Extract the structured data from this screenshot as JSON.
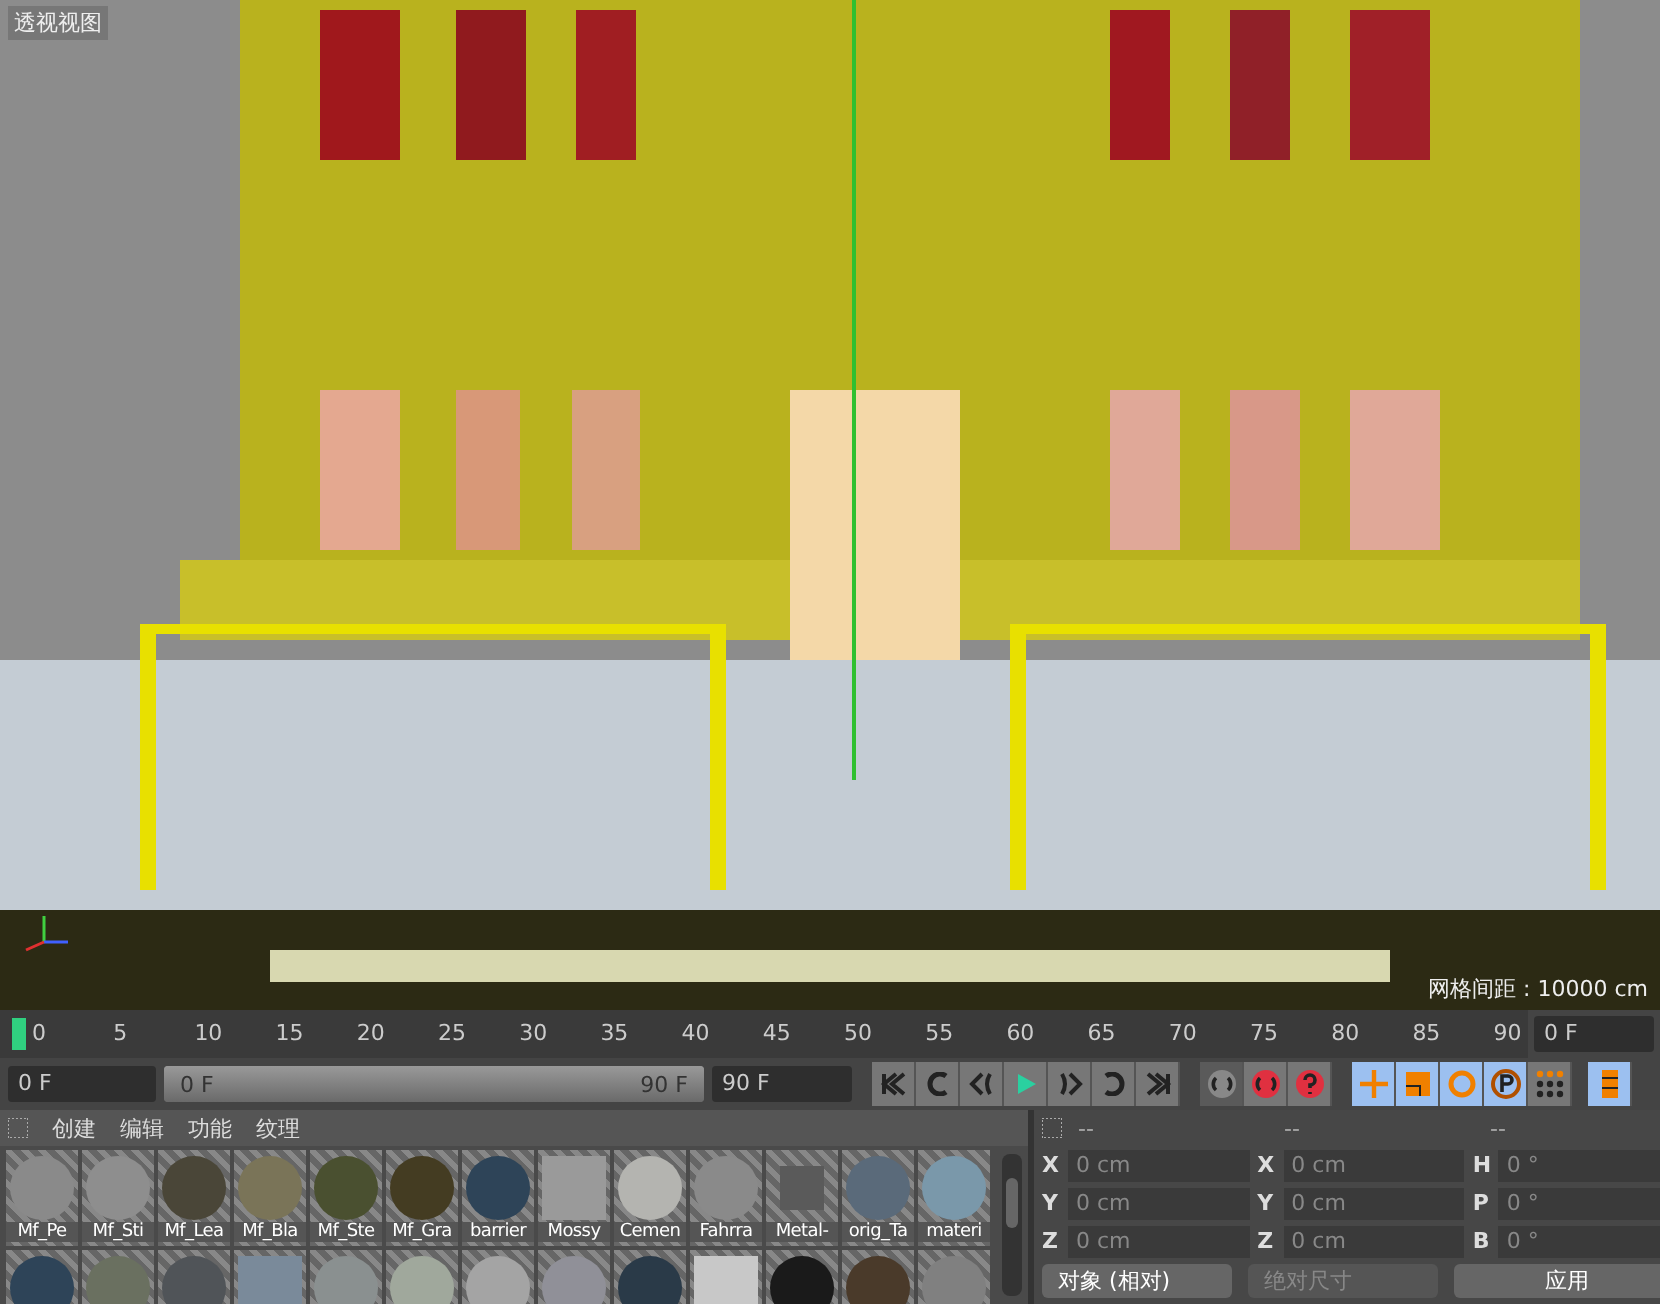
{
  "viewport": {
    "title": "透视视图",
    "grid_spacing": "网格间距 : 10000 cm"
  },
  "timeline": {
    "ticks": [
      "0",
      "5",
      "10",
      "15",
      "20",
      "25",
      "30",
      "35",
      "40",
      "45",
      "50",
      "55",
      "60",
      "65",
      "70",
      "75",
      "80",
      "85",
      "90"
    ],
    "current_frame": "0 F"
  },
  "playback": {
    "start_field": "0 F",
    "range_start": "0 F",
    "range": {
      "level": 1
    },
    "range_end": "90 F",
    "end_field": "90 F",
    "buttons": [
      {
        "kind": "first"
      },
      {
        "kind": "prev-key"
      },
      {
        "kind": "prev-frame"
      },
      {
        "kind": "play"
      },
      {
        "kind": "next-frame"
      },
      {
        "kind": "next-key"
      },
      {
        "kind": "last"
      }
    ],
    "key_buttons": [
      {
        "kind": "record",
        "disabled": true
      },
      {
        "kind": "auto-key",
        "disabled": false
      },
      {
        "kind": "key-help",
        "disabled": false
      }
    ],
    "tools": [
      {
        "kind": "move",
        "selected": true
      },
      {
        "kind": "scale",
        "selected": true
      },
      {
        "kind": "rotate",
        "selected": true
      },
      {
        "kind": "param",
        "selected": true
      },
      {
        "kind": "grid",
        "selected": false
      },
      {
        "kind": "film",
        "selected": true
      }
    ]
  },
  "materials": {
    "menu": [
      "创建",
      "编辑",
      "功能",
      "纹理"
    ],
    "rows": [
      [
        {
          "name": "Mf_Pe",
          "kind": "sphere",
          "color": "#8a8a8a"
        },
        {
          "name": "Mf_Sti",
          "kind": "sphere",
          "color": "#8e8e8e"
        },
        {
          "name": "Mf_Lea",
          "kind": "sphere",
          "color": "#4a4638"
        },
        {
          "name": "Mf_Bla",
          "kind": "sphere",
          "color": "#7a7458"
        },
        {
          "name": "Mf_Ste",
          "kind": "sphere",
          "color": "#4a5030"
        },
        {
          "name": "Mf_Gra",
          "kind": "sphere",
          "color": "#443c22"
        },
        {
          "name": "barrier",
          "kind": "sphere",
          "color": "#2e4458"
        },
        {
          "name": "Mossy",
          "kind": "texture",
          "color": "#9a9a9a"
        },
        {
          "name": "Cemen",
          "kind": "sphere",
          "color": "#b4b4b0"
        },
        {
          "name": "Fahrra",
          "kind": "sphere",
          "color": "#8a8a8a"
        },
        {
          "name": "Metal-",
          "kind": "cube",
          "color": "#5a5a5a"
        },
        {
          "name": "orig_Ta",
          "kind": "sphere",
          "color": "#5a6a7a"
        },
        {
          "name": "materi",
          "kind": "sphere",
          "color": "#7a98aa"
        }
      ],
      [
        {
          "kind": "sphere",
          "color": "#2e4458"
        },
        {
          "kind": "sphere",
          "color": "#6a7060"
        },
        {
          "kind": "sphere",
          "color": "#505458"
        },
        {
          "kind": "texture",
          "color": "#7a8a9a"
        },
        {
          "kind": "sphere",
          "color": "#8a9090"
        },
        {
          "kind": "sphere",
          "color": "#a0a89c"
        },
        {
          "kind": "sphere",
          "color": "#a4a4a4"
        },
        {
          "kind": "sphere",
          "color": "#909098"
        },
        {
          "kind": "sphere",
          "color": "#2a3a48"
        },
        {
          "kind": "texture",
          "color": "#c8c8c8"
        },
        {
          "kind": "sphere",
          "color": "#1a1a1a"
        },
        {
          "kind": "sphere",
          "color": "#4a3a2a"
        },
        {
          "kind": "sphere",
          "color": "#808080"
        }
      ]
    ]
  },
  "coordinates": {
    "headers": [
      "--",
      "--",
      "--"
    ],
    "columns": [
      [
        {
          "axis": "X",
          "value": "0 cm"
        },
        {
          "axis": "Y",
          "value": "0 cm"
        },
        {
          "axis": "Z",
          "value": "0 cm"
        }
      ],
      [
        {
          "axis": "X",
          "value": "0 cm"
        },
        {
          "axis": "Y",
          "value": "0 cm"
        },
        {
          "axis": "Z",
          "value": "0 cm"
        }
      ],
      [
        {
          "axis": "H",
          "value": "0 °"
        },
        {
          "axis": "P",
          "value": "0 °"
        },
        {
          "axis": "B",
          "value": "0 °"
        }
      ]
    ],
    "mode_dropdown": {
      "value": "对象 (相对)",
      "disabled": false
    },
    "size_dropdown": {
      "value": "绝对尺寸",
      "disabled": true
    },
    "apply_button": "应用"
  }
}
